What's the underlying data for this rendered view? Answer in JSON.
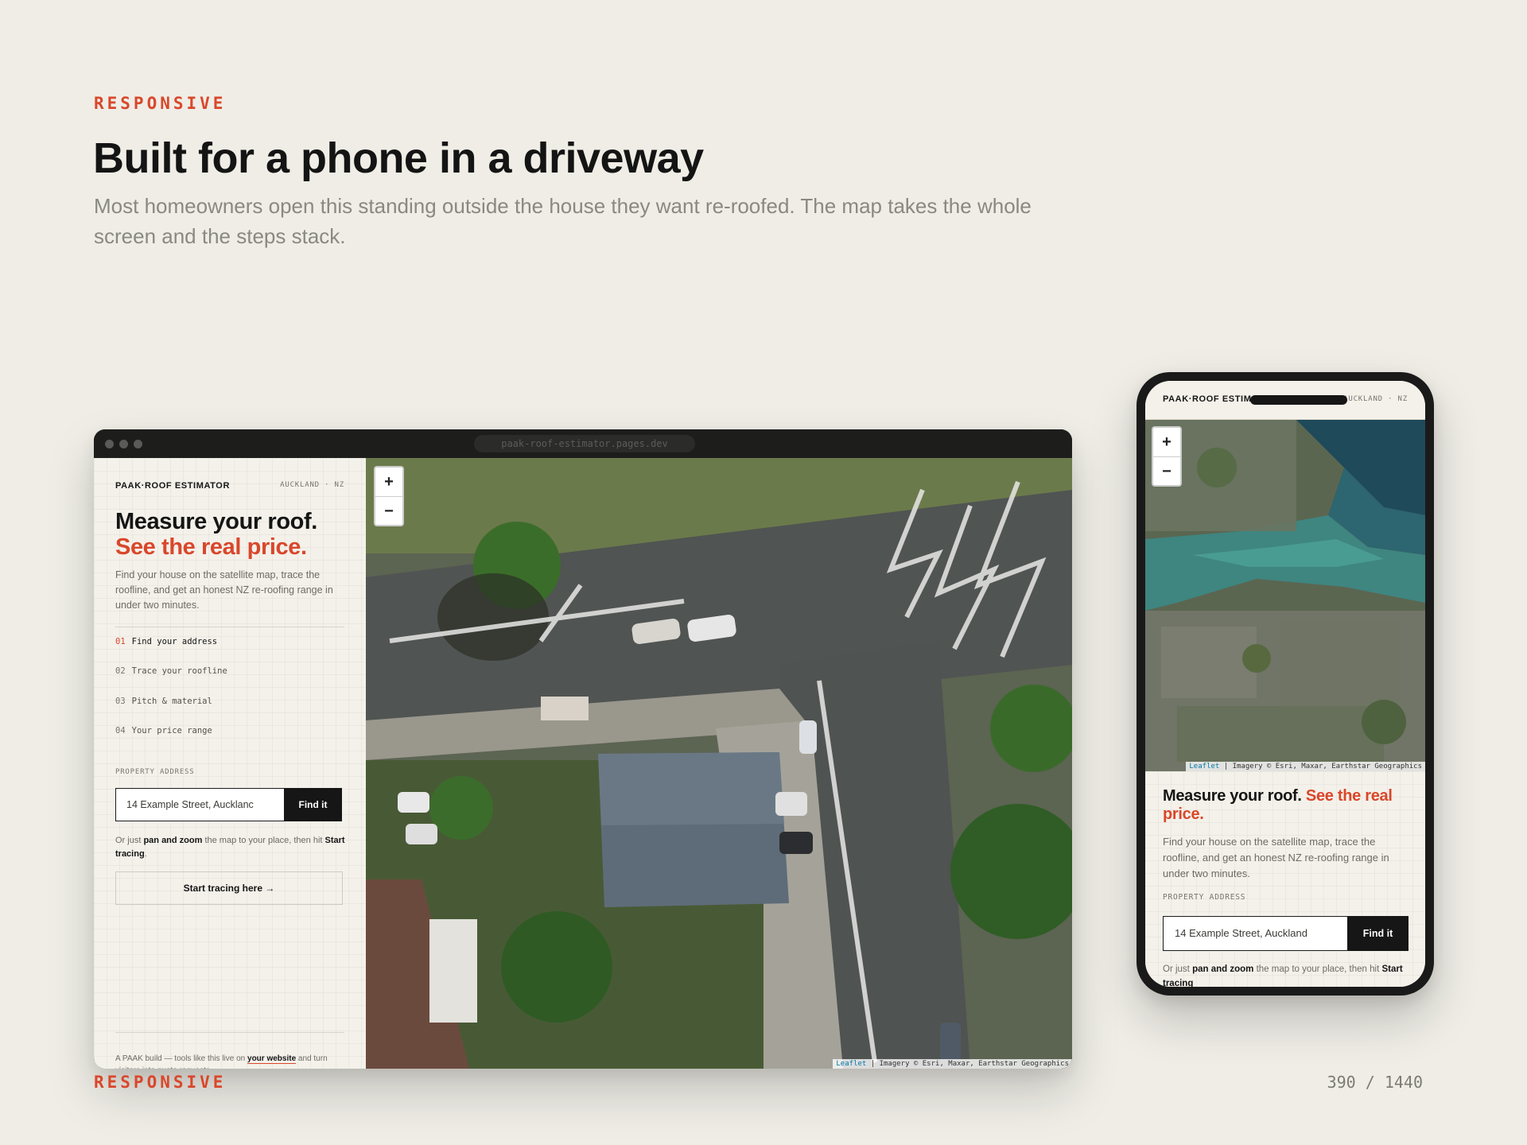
{
  "section": {
    "eyebrow": "RESPONSIVE",
    "title": "Built for a phone in a driveway",
    "subtitle": "Most homeowners open this standing outside the house they want re-roofed. The map takes the whole screen and the steps stack.",
    "footer_label": "RESPONSIVE",
    "footer_counter": "390 / 1440"
  },
  "desktop": {
    "url": "paak-roof-estimator.pages.dev",
    "brand": "PAAK·ROOF ESTIMATOR",
    "location": "AUCKLAND · NZ",
    "title_line1": "Measure your roof.",
    "title_line2": "See the real price.",
    "description": "Find your house on the satellite map, trace the roofline, and get an honest NZ re-roofing range in under two minutes.",
    "steps": [
      {
        "num": "01",
        "label": "Find your address"
      },
      {
        "num": "02",
        "label": "Trace your roofline"
      },
      {
        "num": "03",
        "label": "Pitch & material"
      },
      {
        "num": "04",
        "label": "Your price range"
      }
    ],
    "address_label": "PROPERTY ADDRESS",
    "address_value": "14 Example Street, Aucklanc",
    "find_button": "Find it",
    "hint_prefix": "Or just ",
    "hint_bold1": "pan and zoom",
    "hint_middle": " the map to your place, then hit ",
    "hint_bold2": "Start tracing",
    "hint_suffix": ".",
    "trace_button": "Start tracing here →",
    "footer_prefix": "A PAAK build — tools like this live on ",
    "footer_link": "your website",
    "footer_suffix": " and turn visitors into quote requests.",
    "zoom_in": "+",
    "zoom_out": "−",
    "attribution_leaflet": "Leaflet",
    "attribution_rest": " | Imagery © Esri, Maxar, Earthstar Geographics"
  },
  "mobile": {
    "brand": "PAAK·ROOF ESTIMATOR",
    "location": "AUCKLAND · NZ",
    "title_plain": "Measure your roof. ",
    "title_accent": "See the real price.",
    "description": "Find your house on the satellite map, trace the roofline, and get an honest NZ re-roofing range in under two minutes.",
    "address_label": "PROPERTY ADDRESS",
    "address_value": "14 Example Street, Auckland",
    "find_button": "Find it",
    "hint_prefix": "Or just ",
    "hint_bold1": "pan and zoom",
    "hint_middle": " the map to your place, then hit ",
    "hint_bold2": "Start tracing",
    "zoom_in": "+",
    "zoom_out": "−",
    "attribution_leaflet": "Leaflet",
    "attribution_rest": " | Imagery © Esri, Maxar, Earthstar Geographics"
  },
  "colors": {
    "accent": "#d9472b",
    "background": "#efede6",
    "panel": "#f4f1ea",
    "ink": "#151515"
  }
}
